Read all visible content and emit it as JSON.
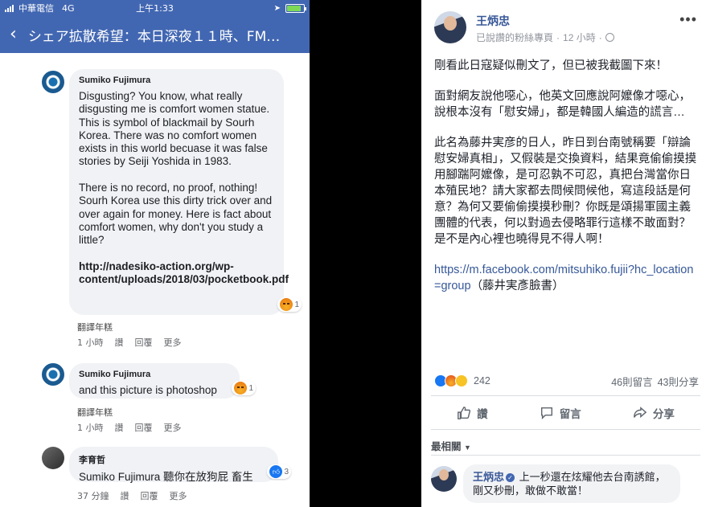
{
  "left": {
    "status_bar": {
      "carrier": "中華電信",
      "network": "4G",
      "time": "上午1:33",
      "battery_level": 0.85
    },
    "nav": {
      "title": "シェア拡散希望：本日深夜１１時、FM…"
    },
    "comments": [
      {
        "author": "Sumiko Fujimura",
        "body": "Disgusting? You know, what really disgusting me is comfort women statue. This is symbol of blackmail by Sourh Korea. There was no comfort women exists in this world becuase it was false stories by Seiji Yoshida in 1983.\n\nThere is no record, no proof, nothing! Sourh Korea use this dirty trick over and over again for money. Here is fact about comfort women, why don't you study a little?\n\n",
        "link": "http://nadesiko-action.org/wp-content/uploads/2018/03/pocketbook.pdf",
        "reaction_count": "1",
        "translate": "翻譯年糕",
        "time": "1 小時",
        "like": "讚",
        "reply": "回覆",
        "more": "更多"
      },
      {
        "author": "Sumiko Fujimura",
        "body": "and this picture is photoshop",
        "reaction_count": "1",
        "translate": "翻譯年糕",
        "time": "1 小時",
        "like": "讚",
        "reply": "回覆",
        "more": "更多"
      },
      {
        "author": "李育哲",
        "body": "Sumiko Fujimura 聽你在放狗屁 畜生",
        "reaction_count": "3",
        "time": "37 分鐘",
        "like": "讚",
        "reply": "回覆",
        "more": "更多"
      }
    ]
  },
  "right": {
    "author": "王炳忠",
    "meta_following": "已說讚的粉絲專頁",
    "meta_time": "12 小時",
    "more": "•••",
    "paragraphs": [
      "剛看此日寇疑似刪文了，但已被我截圖下來！",
      "面對網友說他噁心，他英文回應說阿嬤像才噁心，說根本沒有「慰安婦」，都是韓國人編造的謊言…",
      "此名為藤井実彦的日人，昨日到台南號稱要「辯論慰安婦真相」，又假裝是交換資料，結果竟偷偷摸摸用腳踹阿嬤像，是可忍孰不可忍，真把台灣當你日本殖民地？請大家都去問候問候他，寫這段話是何意？為何又要偷偷摸摸秒刪？你既是頌揚軍國主義團體的代表，何以對過去侵略罪行這樣不敢面對？是不是內心裡也曉得見不得人啊！"
    ],
    "url": "https://m.facebook.com/mitsuhiko.fujii?hc_location=group",
    "url_note": "（藤井実彥臉書）",
    "reaction_total": "242",
    "comment_count": "46則留言",
    "share_count": "43則分享",
    "actions": {
      "like": "讚",
      "comment": "留言",
      "share": "分享"
    },
    "sort_label": "最相關",
    "reply": {
      "author": "王炳忠",
      "text": "上一秒還在炫耀他去台南誘館，剛又秒刪，敢做不敢當！"
    }
  }
}
